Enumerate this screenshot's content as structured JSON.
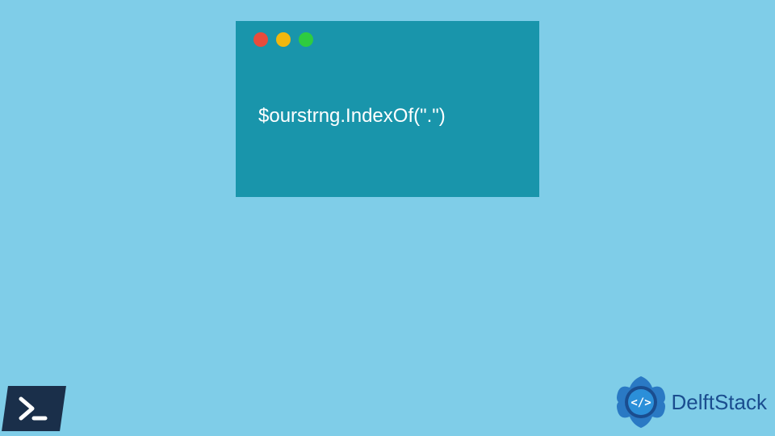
{
  "code_window": {
    "content": "$ourstrng.IndexOf(\".\")"
  },
  "brand": {
    "name": "DelftStack"
  },
  "colors": {
    "background": "#7FCDE8",
    "window": "#1995AB",
    "red": "#E74C3C",
    "yellow": "#F1B70E",
    "green": "#2ECC40",
    "brand": "#1A4D8F",
    "powershell": "#1A2F4A"
  }
}
